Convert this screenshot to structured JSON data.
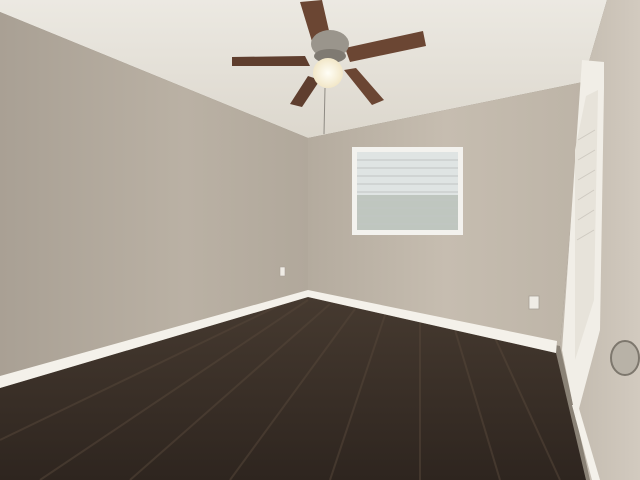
{
  "scene": {
    "description_free": true,
    "colors": {
      "ceiling": "#e6e2da",
      "wall_left": "#b7aea1",
      "wall_back": "#c4bbae",
      "wall_right": "#c9c1b5",
      "floor": "#3a2f27",
      "floor_grain": "#4f4237",
      "baseboard": "#f4f1ea",
      "window_frame": "#f3f2ee",
      "window_glass": "#dfe4e3",
      "blind_line": "#c9ccca",
      "fan_blade": "#6b4633",
      "fan_metal": "#9a958c",
      "light_globe": "#fffbe9",
      "door_frame": "#f1eee7",
      "door_knob": "#b8b2a7"
    }
  }
}
